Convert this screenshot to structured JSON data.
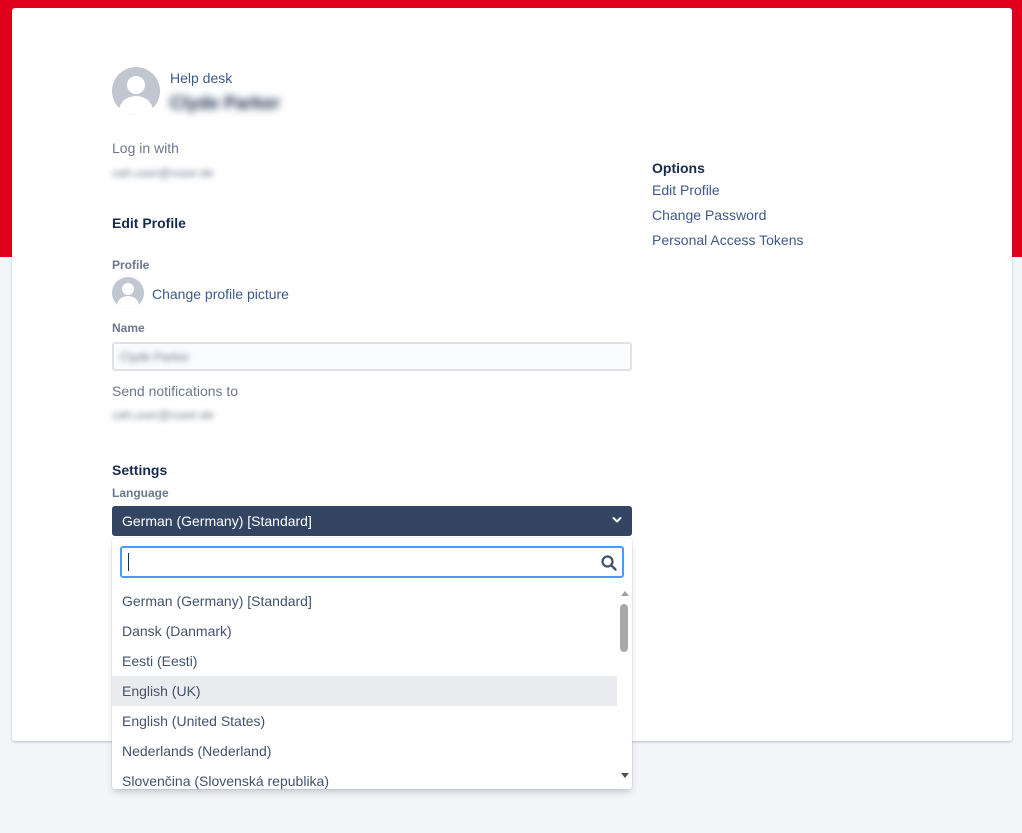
{
  "header": {
    "service_desk_label": "Help desk",
    "user_name": "Clyde Parker"
  },
  "login": {
    "label": "Log in with",
    "email": "cah.user@ruser.de"
  },
  "edit_profile": {
    "heading": "Edit Profile",
    "profile_label": "Profile",
    "change_picture": "Change profile picture",
    "name_label": "Name",
    "name_value": "Clyde Parker",
    "notifications_label": "Send notifications to",
    "notifications_email": "cah.user@ruser.de"
  },
  "settings": {
    "heading": "Settings",
    "language_label": "Language",
    "language_selected": "German (Germany) [Standard]",
    "search_value": "",
    "language_options": [
      "German (Germany) [Standard]",
      "Dansk (Danmark)",
      "Eesti (Eesti)",
      "English (UK)",
      "English (United States)",
      "Nederlands (Nederland)",
      "Slovenčina (Slovenská republika)"
    ],
    "hovered_option": "English (UK)"
  },
  "sidebar": {
    "title": "Options",
    "links": [
      "Edit Profile",
      "Change Password",
      "Personal Access Tokens"
    ]
  },
  "colors": {
    "banner": "#e0001b",
    "select_bg": "#344563",
    "link": "#3d5a8a",
    "focus": "#4c9aff"
  }
}
